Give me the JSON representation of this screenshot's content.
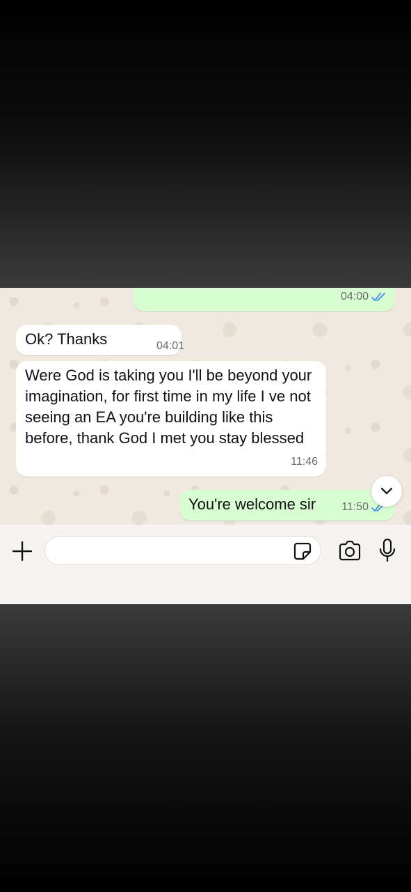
{
  "colors": {
    "outgoing_bubble": "#d9fdd3",
    "incoming_bubble": "#ffffff",
    "read_ticks": "#3b8eea",
    "chat_background": "#efe9e0"
  },
  "messages": [
    {
      "direction": "outgoing",
      "text": "",
      "time": "04:00",
      "status": "read"
    },
    {
      "direction": "incoming",
      "text": "Ok? Thanks",
      "time": "04:01"
    },
    {
      "direction": "incoming",
      "text": "Were God is taking you I'll be beyond your imagination, for first time in my life I ve not seeing an EA you're building like this before, thank God I met you stay blessed",
      "time": "11:46"
    },
    {
      "direction": "outgoing",
      "text": "You're welcome sir",
      "time": "11:50",
      "status": "read"
    }
  ],
  "composer": {
    "input_value": "",
    "icons": [
      "plus-icon",
      "sticker-icon",
      "camera-icon",
      "microphone-icon"
    ]
  },
  "scroll_button_icon": "chevron-down-icon"
}
